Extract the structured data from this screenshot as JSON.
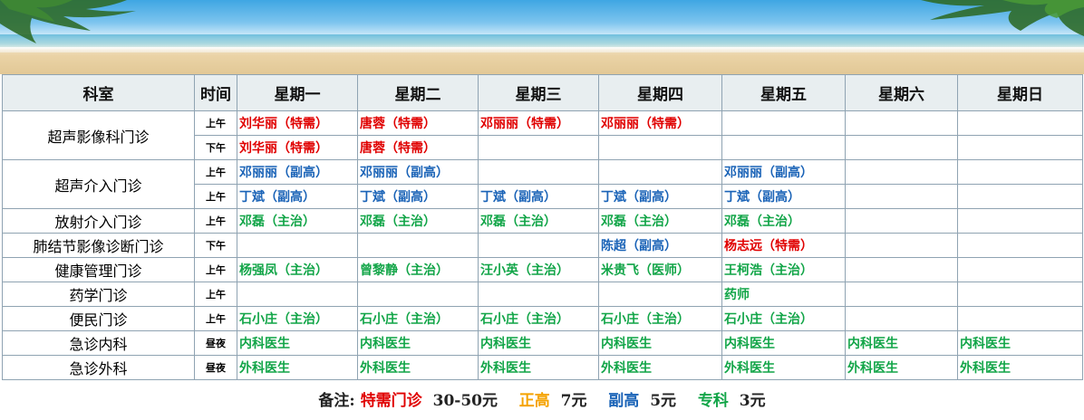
{
  "header": {
    "dept": "科室",
    "time": "时间",
    "days": [
      "星期一",
      "星期二",
      "星期三",
      "星期四",
      "星期五",
      "星期六",
      "星期日"
    ]
  },
  "rows": [
    {
      "dept": "超声影像科门诊",
      "time": "上午",
      "cells": [
        [
          "刘华丽（特需）",
          "red"
        ],
        [
          "唐蓉（特需）",
          "red"
        ],
        [
          "邓丽丽（特需）",
          "red"
        ],
        [
          "邓丽丽（特需）",
          "red"
        ],
        [
          "",
          ""
        ],
        [
          "",
          ""
        ],
        [
          "",
          ""
        ]
      ]
    },
    {
      "dept": "",
      "time": "下午",
      "cells": [
        [
          "刘华丽（特需）",
          "red"
        ],
        [
          "唐蓉（特需）",
          "red"
        ],
        [
          "",
          ""
        ],
        [
          "",
          ""
        ],
        [
          "",
          ""
        ],
        [
          "",
          ""
        ],
        [
          "",
          ""
        ]
      ]
    },
    {
      "dept": "超声介入门诊",
      "time": "上午",
      "cells": [
        [
          "邓丽丽（副高）",
          "blue"
        ],
        [
          "邓丽丽（副高）",
          "blue"
        ],
        [
          "",
          ""
        ],
        [
          "",
          ""
        ],
        [
          "邓丽丽（副高）",
          "blue"
        ],
        [
          "",
          ""
        ],
        [
          "",
          ""
        ]
      ]
    },
    {
      "dept": "",
      "time": "上午",
      "cells": [
        [
          "丁斌（副高）",
          "blue"
        ],
        [
          "丁斌（副高）",
          "blue"
        ],
        [
          "丁斌（副高）",
          "blue"
        ],
        [
          "丁斌（副高）",
          "blue"
        ],
        [
          "丁斌（副高）",
          "blue"
        ],
        [
          "",
          ""
        ],
        [
          "",
          ""
        ]
      ]
    },
    {
      "dept": "放射介入门诊",
      "time": "上午",
      "cells": [
        [
          "邓磊（主治）",
          "green"
        ],
        [
          "邓磊（主治）",
          "green"
        ],
        [
          "邓磊（主治）",
          "green"
        ],
        [
          "邓磊（主治）",
          "green"
        ],
        [
          "邓磊（主治）",
          "green"
        ],
        [
          "",
          ""
        ],
        [
          "",
          ""
        ]
      ]
    },
    {
      "dept": "肺结节影像诊断门诊",
      "time": "下午",
      "cells": [
        [
          "",
          ""
        ],
        [
          "",
          ""
        ],
        [
          "",
          ""
        ],
        [
          "陈超（副高）",
          "blue"
        ],
        [
          "杨志远（特需）",
          "red"
        ],
        [
          "",
          ""
        ],
        [
          "",
          ""
        ]
      ]
    },
    {
      "dept": "健康管理门诊",
      "time": "上午",
      "cells": [
        [
          "杨强凤（主治）",
          "green"
        ],
        [
          "曾黎静（主治）",
          "green"
        ],
        [
          "汪小英（主治）",
          "green"
        ],
        [
          "米贵飞（医师）",
          "green"
        ],
        [
          "王柯浩（主治）",
          "green"
        ],
        [
          "",
          ""
        ],
        [
          "",
          ""
        ]
      ]
    },
    {
      "dept": "药学门诊",
      "time": "上午",
      "cells": [
        [
          "",
          ""
        ],
        [
          "",
          ""
        ],
        [
          "",
          ""
        ],
        [
          "",
          ""
        ],
        [
          "药师",
          "green"
        ],
        [
          "",
          ""
        ],
        [
          "",
          ""
        ]
      ]
    },
    {
      "dept": "便民门诊",
      "time": "上午",
      "cells": [
        [
          "石小庄（主治）",
          "green"
        ],
        [
          "石小庄（主治）",
          "green"
        ],
        [
          "石小庄（主治）",
          "green"
        ],
        [
          "石小庄（主治）",
          "green"
        ],
        [
          "石小庄（主治）",
          "green"
        ],
        [
          "",
          ""
        ],
        [
          "",
          ""
        ]
      ]
    },
    {
      "dept": "急诊内科",
      "time": "昼夜",
      "cells": [
        [
          "内科医生",
          "green"
        ],
        [
          "内科医生",
          "green"
        ],
        [
          "内科医生",
          "green"
        ],
        [
          "内科医生",
          "green"
        ],
        [
          "内科医生",
          "green"
        ],
        [
          "内科医生",
          "green"
        ],
        [
          "内科医生",
          "green"
        ]
      ]
    },
    {
      "dept": "急诊外科",
      "time": "昼夜",
      "cells": [
        [
          "外科医生",
          "green"
        ],
        [
          "外科医生",
          "green"
        ],
        [
          "外科医生",
          "green"
        ],
        [
          "外科医生",
          "green"
        ],
        [
          "外科医生",
          "green"
        ],
        [
          "外科医生",
          "green"
        ],
        [
          "外科医生",
          "green"
        ]
      ]
    }
  ],
  "note": {
    "label": "备注:",
    "special": "特需门诊",
    "special_price": "30-50元",
    "senior": "正高",
    "senior_price": "7元",
    "associate": "副高",
    "associate_price": "5元",
    "specialist": "专科",
    "specialist_price": "3元"
  },
  "colors": {
    "special": "#e00000",
    "senior": "#f5a300",
    "associate": "#1a63b7",
    "attending": "#12a548",
    "header_bg": "#e8eef0"
  }
}
